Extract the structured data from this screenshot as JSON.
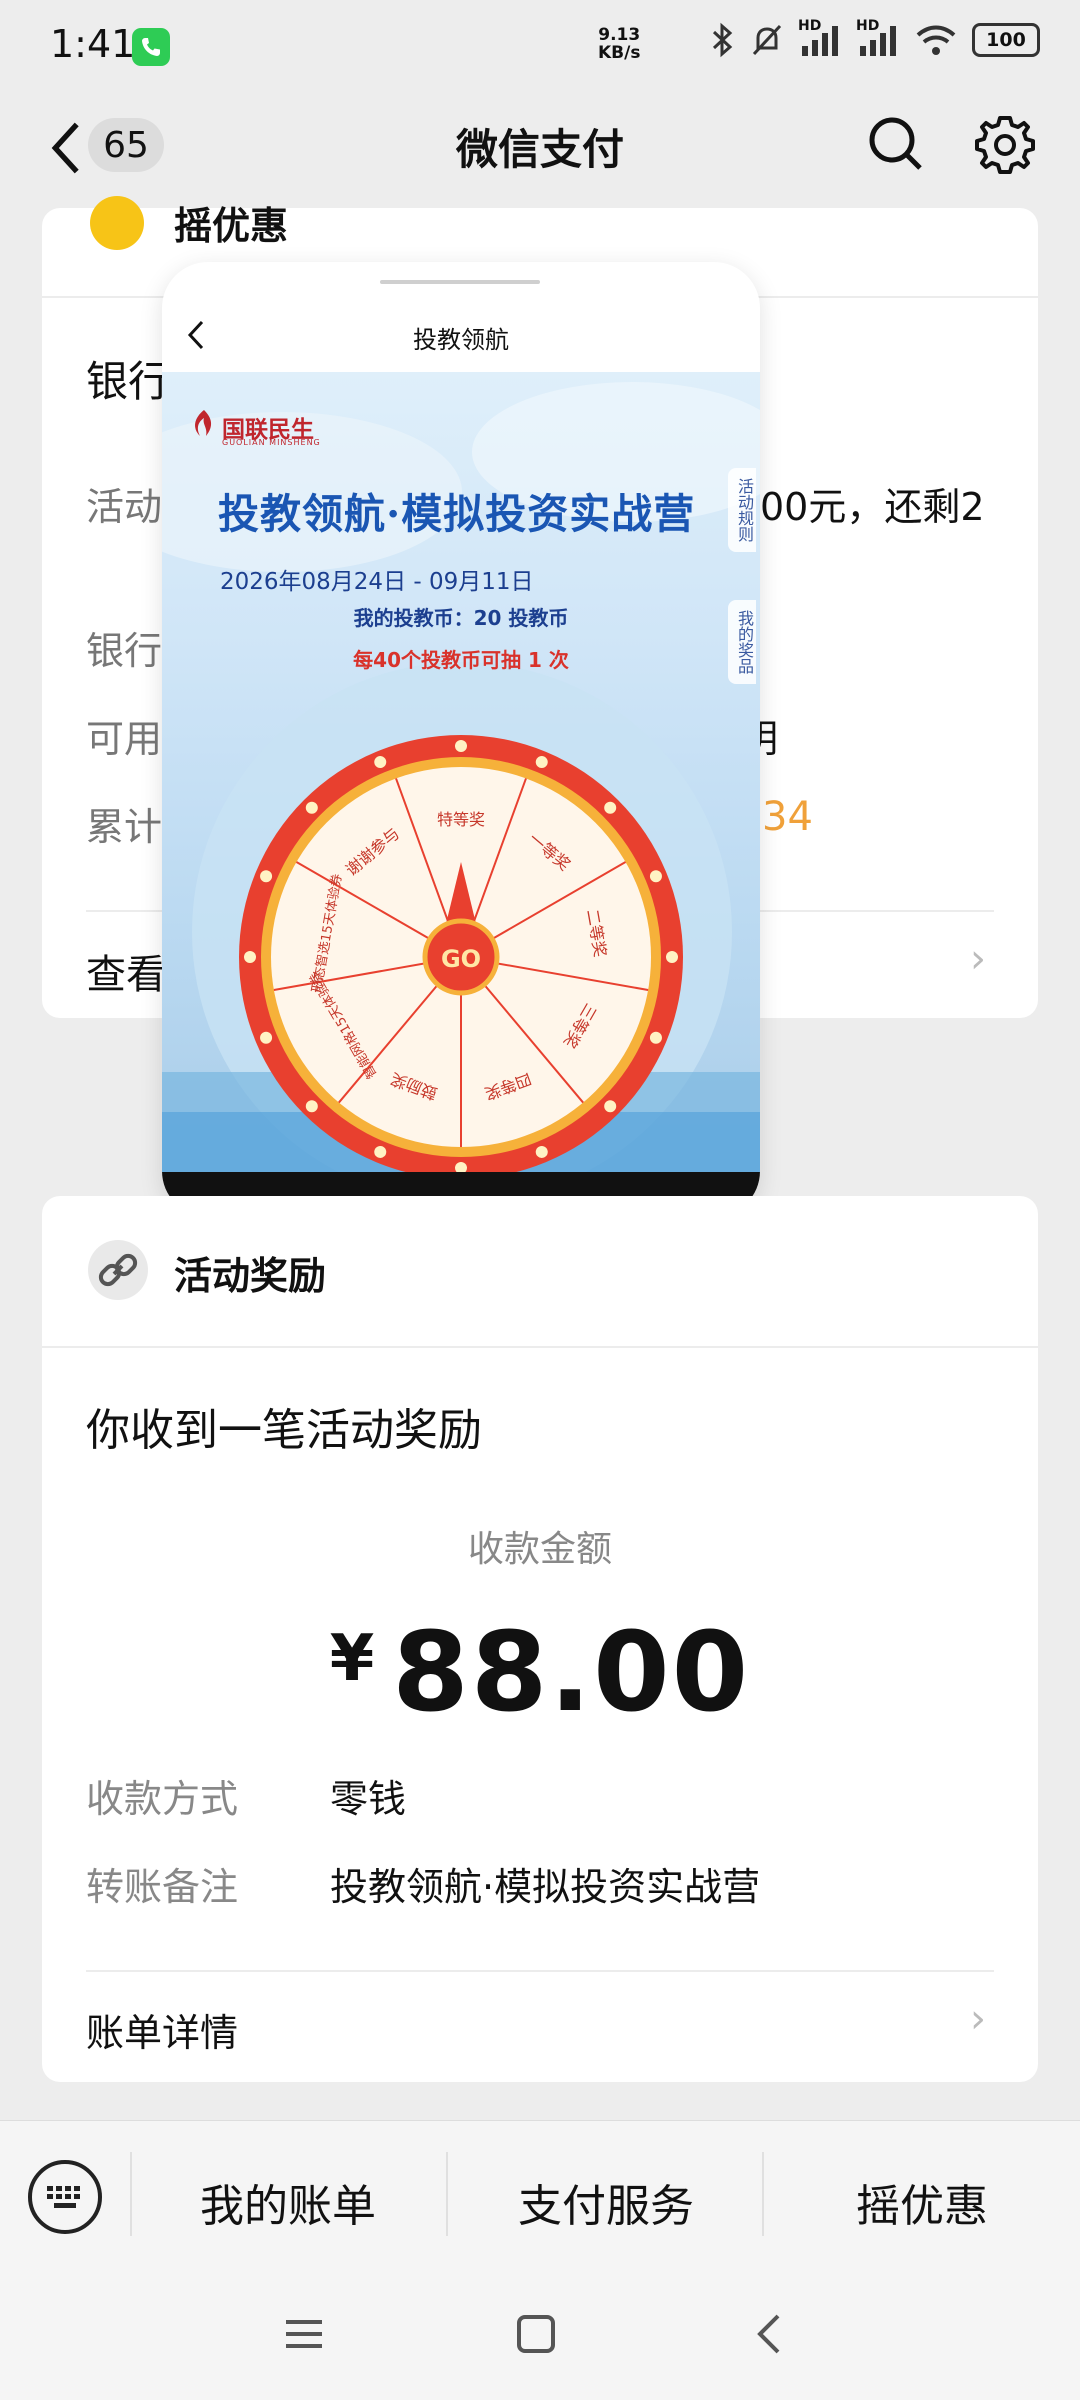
{
  "status": {
    "time": "1:41",
    "net_speed_top": "9.13",
    "net_speed_bottom": "KB/s",
    "signal1": "HD",
    "signal2": "HD",
    "battery": "100"
  },
  "nav": {
    "badge": "65",
    "title": "微信支付"
  },
  "card1": {
    "section_title": "摇优惠",
    "row1": "银行",
    "row2_prefix": "活动",
    "row2_suffix": "00元，还剩2",
    "row3": "银行",
    "row4": "可用",
    "row4_suffix": "明",
    "row5": "累计",
    "row5_value": "34",
    "row6": "查看"
  },
  "popup": {
    "title": "投教领航",
    "logo": "国联民生",
    "logo_sub": "GUOLIAN MINSHENG",
    "hero_title": "投教领航·模拟投资实战营",
    "date_range": "2026年08月24日 - 09月11日",
    "coins": "我的投教币：20 投教币",
    "draw_rule": "每40个投教币可抽 1 次",
    "side_tab_rules": "活动规则",
    "side_tab_prizes": "我的奖品",
    "wheel_center": "GO",
    "wheel_segments": [
      "特等奖",
      "一等奖",
      "二等奖",
      "三等奖",
      "四等奖",
      "鼓励奖",
      "智能网格15天体验券",
      "形态智选15天体验券",
      "谢谢参与"
    ]
  },
  "card2": {
    "title": "活动奖励",
    "received": "你收到一笔活动奖励",
    "amount_label": "收款金额",
    "currency": "¥",
    "amount": "88.00",
    "method_label": "收款方式",
    "method_value": "零钱",
    "note_label": "转账备注",
    "note_value": "投教领航·模拟投资实战营",
    "bill_details": "账单详情"
  },
  "tabbar": {
    "tab1": "我的账单",
    "tab2": "支付服务",
    "tab3": "摇优惠"
  },
  "colors": {
    "accent_orange": "#f0a13a",
    "wechat_green": "#2ecc55",
    "wheel_red": "#e8402f",
    "hero_blue": "#1a56b3"
  }
}
